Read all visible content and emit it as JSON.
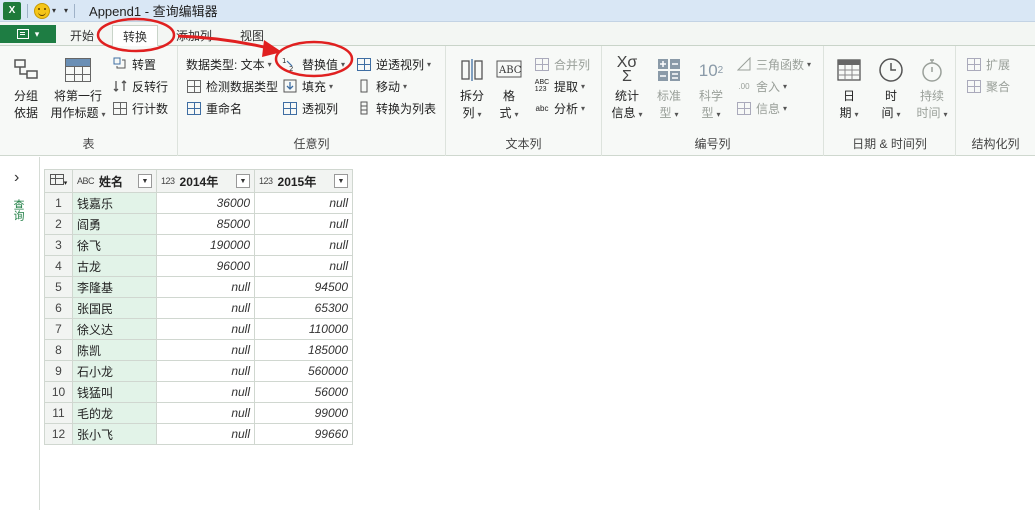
{
  "window": {
    "title": "Append1 - 查询编辑器"
  },
  "tabs": [
    {
      "label": "开始"
    },
    {
      "label": "转换"
    },
    {
      "label": "添加列"
    },
    {
      "label": "视图"
    }
  ],
  "ribbon": {
    "table": {
      "label": "表",
      "group_by_1": "分组",
      "group_by_2": "依据",
      "first_row_1": "将第一行",
      "first_row_2": "用作标题",
      "transpose": "转置",
      "reverse_rows": "反转行",
      "count_rows": "行计数"
    },
    "any_column": {
      "label": "任意列",
      "data_type": "数据类型: 文本",
      "detect_type": "检测数据类型",
      "rename": "重命名",
      "replace_values": "替换值",
      "fill": "填充",
      "pivot": "透视列",
      "unpivot": "逆透视列",
      "move": "移动",
      "to_list": "转换为列表"
    },
    "text_column": {
      "label": "文本列",
      "split_1": "拆分",
      "split_2": "列",
      "format_1": "格",
      "format_2": "式",
      "merge": "合并列",
      "extract": "提取",
      "parse": "分析"
    },
    "number_column": {
      "label": "编号列",
      "stats_1": "统计",
      "stats_2": "信息",
      "standard_1": "标准",
      "standard_2": "型",
      "scientific_1": "科学",
      "scientific_2": "型",
      "trig": "三角函数",
      "round": "舍入",
      "info": "信息"
    },
    "datetime": {
      "label": "日期 & 时间列",
      "date_1": "日",
      "date_2": "期",
      "time_1": "时",
      "time_2": "间",
      "duration_1": "持续",
      "duration_2": "时间"
    },
    "structured": {
      "label": "结构化列",
      "expand": "扩展",
      "aggregate": "聚合"
    }
  },
  "nav": {
    "vertical_label": "查询"
  },
  "grid": {
    "columns": [
      {
        "type": "ABC",
        "name": "姓名"
      },
      {
        "type": "123",
        "name": "2014年"
      },
      {
        "type": "123",
        "name": "2015年"
      }
    ],
    "rows": [
      {
        "n": "1",
        "name": "钱嘉乐",
        "y2014": "36000",
        "y2015": "null"
      },
      {
        "n": "2",
        "name": "阎勇",
        "y2014": "85000",
        "y2015": "null"
      },
      {
        "n": "3",
        "name": "徐飞",
        "y2014": "190000",
        "y2015": "null"
      },
      {
        "n": "4",
        "name": "古龙",
        "y2014": "96000",
        "y2015": "null"
      },
      {
        "n": "5",
        "name": "李隆基",
        "y2014": "null",
        "y2015": "94500"
      },
      {
        "n": "6",
        "name": "张国民",
        "y2014": "null",
        "y2015": "65300"
      },
      {
        "n": "7",
        "name": "徐义达",
        "y2014": "null",
        "y2015": "110000"
      },
      {
        "n": "8",
        "name": "陈凯",
        "y2014": "null",
        "y2015": "185000"
      },
      {
        "n": "9",
        "name": "石小龙",
        "y2014": "null",
        "y2015": "560000"
      },
      {
        "n": "10",
        "name": "钱猛叫",
        "y2014": "null",
        "y2015": "56000"
      },
      {
        "n": "11",
        "name": "毛的龙",
        "y2014": "null",
        "y2015": "99000"
      },
      {
        "n": "12",
        "name": "张小飞",
        "y2014": "null",
        "y2015": "99660"
      }
    ]
  },
  "colors": {
    "accent_green": "#1e7d43",
    "annotation_red": "#e02020",
    "key_column": "#e2f3e8"
  }
}
